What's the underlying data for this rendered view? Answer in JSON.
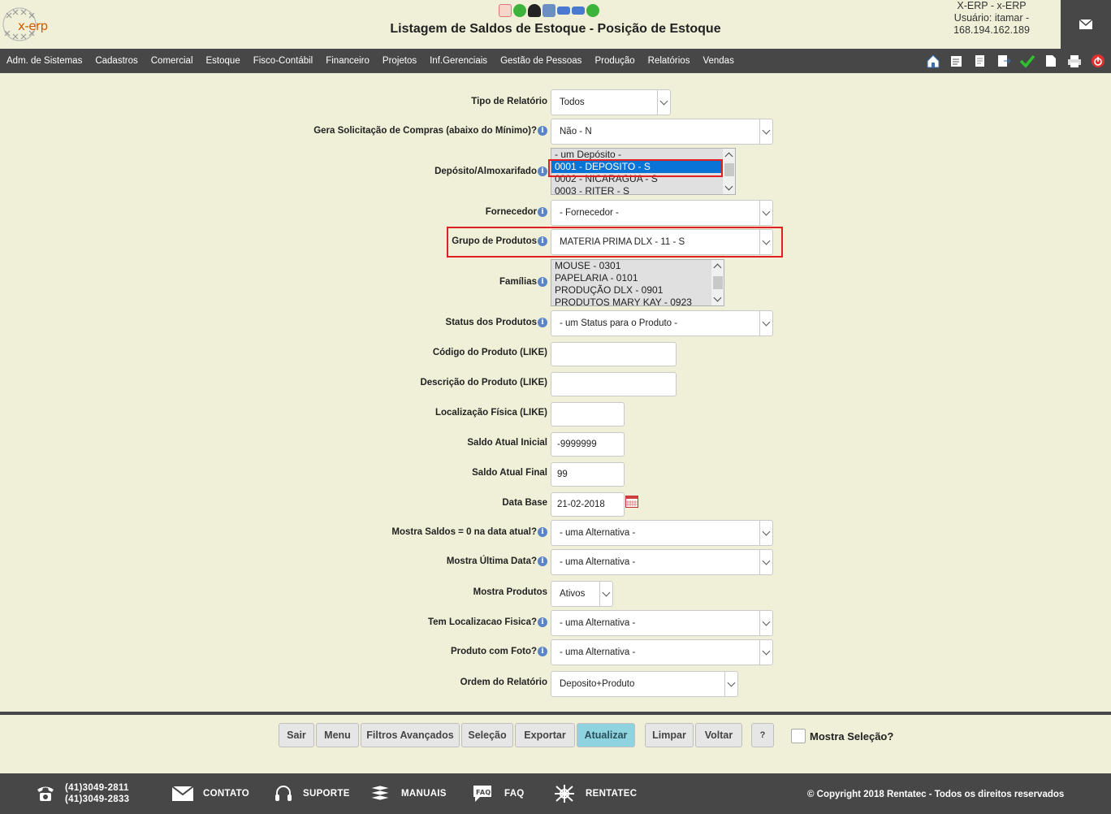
{
  "header": {
    "logo_text": "x-erp",
    "title": "Listagem de Saldos de Estoque - Posição de Estoque",
    "user_line1": "X-ERP - x-ERP",
    "user_line2": "Usuário: itamar -",
    "user_line3": "168.194.162.189"
  },
  "nav": {
    "items": [
      "Adm. de Sistemas",
      "Cadastros",
      "Comercial",
      "Estoque",
      "Fisco-Contábil",
      "Financeiro",
      "Projetos",
      "Inf.Gerenciais",
      "Gestão de Pessoas",
      "Produção",
      "Relatórios",
      "Vendas"
    ]
  },
  "form": {
    "tipo_relatorio": {
      "label": "Tipo de Relatório",
      "value": "Todos"
    },
    "gera_solicitacao": {
      "label": "Gera Solicitação de Compras (abaixo do Mínimo)?",
      "value": "Não - N"
    },
    "deposito": {
      "label": "Depósito/Almoxarifado",
      "options": [
        "- um Depósito -",
        "0001 - DEPOSITO - S",
        "0002 - NICARAGUA - S",
        "0003 - RITER - S"
      ]
    },
    "fornecedor": {
      "label": "Fornecedor",
      "value": "- Fornecedor -"
    },
    "grupo_produtos": {
      "label": "Grupo de Produtos",
      "value": "MATERIA PRIMA DLX - 11 - S"
    },
    "familias": {
      "label": "Famílias",
      "options": [
        "MOUSE - 0301",
        "PAPELARIA - 0101",
        "PRODUÇÃO DLX - 0901",
        "PRODUTOS MARY KAY - 0923"
      ]
    },
    "status_produtos": {
      "label": "Status dos Produtos",
      "value": "- um Status para o Produto -"
    },
    "codigo_produto": {
      "label": "Código do Produto (LIKE)",
      "value": ""
    },
    "descricao_produto": {
      "label": "Descrição do Produto (LIKE)",
      "value": ""
    },
    "localizacao": {
      "label": "Localização Física (LIKE)",
      "value": ""
    },
    "saldo_inicial": {
      "label": "Saldo Atual Inicial",
      "value": "-9999999"
    },
    "saldo_final": {
      "label": "Saldo Atual Final",
      "value": "99"
    },
    "data_base": {
      "label": "Data Base",
      "value": "21-02-2018"
    },
    "mostra_saldos_zero": {
      "label": "Mostra Saldos = 0 na data atual?",
      "value": "- uma Alternativa -"
    },
    "mostra_ultima_data": {
      "label": "Mostra Última Data?",
      "value": "- uma Alternativa -"
    },
    "mostra_produtos": {
      "label": "Mostra Produtos",
      "value": "Ativos"
    },
    "tem_localizacao": {
      "label": "Tem Localizacao Fisica?",
      "value": "- uma Alternativa -"
    },
    "produto_foto": {
      "label": "Produto com Foto?",
      "value": "- uma Alternativa -"
    },
    "ordem": {
      "label": "Ordem do Relatório",
      "value": "Deposito+Produto"
    }
  },
  "buttons": {
    "sair": "Sair",
    "menu": "Menu",
    "filtros": "Filtros Avançados",
    "selecao": "Seleção",
    "exportar": "Exportar",
    "atualizar": "Atualizar",
    "limpar": "Limpar",
    "voltar": "Voltar",
    "help": "?",
    "mostra_selecao": "Mostra Seleção?"
  },
  "footer": {
    "phone1": "(41)3049-2811",
    "phone2": "(41)3049-2833",
    "contato": "CONTATO",
    "suporte": "SUPORTE",
    "manuais": "MANUAIS",
    "faq": "FAQ",
    "rentatec": "RENTATEC",
    "copyright": "© Copyright 2018 Rentatec - Todos os direitos reservados"
  },
  "colors": {
    "background": "#f0f0d8",
    "nav": "#474747",
    "highlight_button": "#8fd3e0",
    "selected_option": "#0a74d6",
    "annotation_box": "#e02020"
  }
}
